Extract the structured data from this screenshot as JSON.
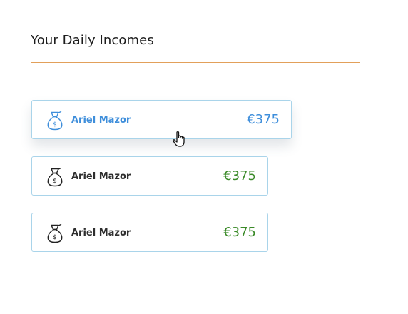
{
  "page": {
    "title": "Your Daily Incomes"
  },
  "incomes": [
    {
      "name": "Ariel Mazor",
      "amount": "€375",
      "icon": "money-bag-icon",
      "state": "hovered"
    },
    {
      "name": "Ariel Mazor",
      "amount": "€375",
      "icon": "money-bag-icon",
      "state": "default"
    },
    {
      "name": "Ariel Mazor",
      "amount": "€375",
      "icon": "money-bag-icon",
      "state": "default"
    }
  ],
  "colors": {
    "accent_rule": "#e2a05a",
    "card_border": "#a9d4ea",
    "active_text": "#3e8edb",
    "amount_green": "#3a8a28",
    "name_text": "#2e2e2e"
  }
}
